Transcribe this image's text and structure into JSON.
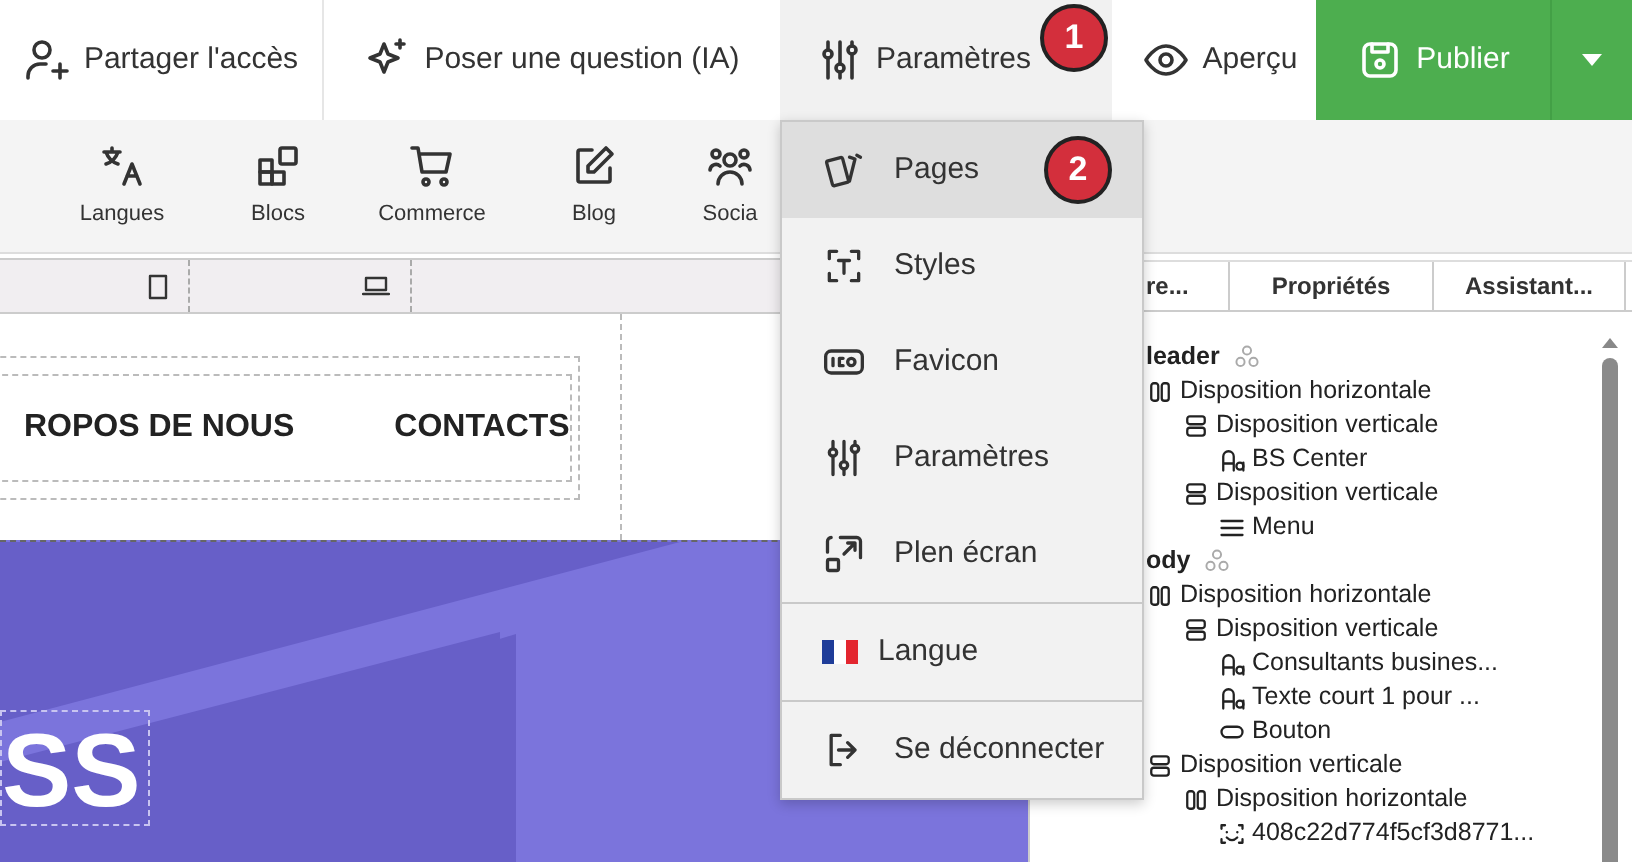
{
  "top_bar": {
    "items": [
      {
        "kind": "share",
        "label": "Partager l'accès",
        "selected": false
      },
      {
        "kind": "ai",
        "label": "Poser une question (IA)",
        "selected": false
      },
      {
        "kind": "settings",
        "label": "Paramètres",
        "selected": true
      },
      {
        "kind": "preview",
        "label": "Aperçu",
        "selected": false
      }
    ],
    "publish_button": {
      "label": "Publier"
    }
  },
  "toolbar": {
    "items": [
      {
        "kind": "languages",
        "label": "Langues"
      },
      {
        "kind": "blocks",
        "label": "Blocs"
      },
      {
        "kind": "commerce",
        "label": "Commerce"
      },
      {
        "kind": "blog",
        "label": "Blog"
      },
      {
        "kind": "social",
        "label": "Socia"
      }
    ]
  },
  "canvas": {
    "nav_links": [
      "ROPOS DE NOUS",
      "CONTACTS"
    ],
    "hero_heading": "SS"
  },
  "panel": {
    "tabs": [
      {
        "label": "re..."
      },
      {
        "label": "Propriétés"
      },
      {
        "label": "Assistant..."
      }
    ],
    "tree": [
      {
        "kind": "root",
        "label": "leader",
        "children": [
          {
            "kind": "hlayout",
            "label": "Disposition horizontale",
            "children": [
              {
                "kind": "vlayout",
                "label": "Disposition verticale",
                "children": [
                  {
                    "kind": "text",
                    "label": "BS Center"
                  }
                ]
              },
              {
                "kind": "vlayout",
                "label": "Disposition verticale",
                "children": [
                  {
                    "kind": "menu",
                    "label": "Menu"
                  }
                ]
              }
            ]
          }
        ]
      },
      {
        "kind": "root",
        "label": "ody",
        "children": [
          {
            "kind": "hlayout",
            "label": "Disposition horizontale",
            "children": [
              {
                "kind": "vlayout",
                "label": "Disposition verticale",
                "children": [
                  {
                    "kind": "text",
                    "label": "Consultants busines..."
                  },
                  {
                    "kind": "text",
                    "label": "Texte court 1 pour ..."
                  },
                  {
                    "kind": "button",
                    "label": "Bouton"
                  }
                ]
              }
            ]
          },
          {
            "kind": "vlayout",
            "label": "Disposition verticale",
            "children": [
              {
                "kind": "hlayout",
                "label": "Disposition horizontale",
                "children": [
                  {
                    "kind": "image",
                    "label": "408c22d774f5cf3d8771..."
                  }
                ]
              }
            ]
          }
        ]
      }
    ]
  },
  "dropdown_menu": {
    "sections": [
      [
        {
          "kind": "pages",
          "label": "Pages",
          "highlighted": true
        },
        {
          "kind": "styles",
          "label": "Styles",
          "highlighted": false
        },
        {
          "kind": "favicon",
          "label": "Favicon",
          "highlighted": false
        },
        {
          "kind": "settings",
          "label": "Paramètres",
          "highlighted": false
        },
        {
          "kind": "fullscreen",
          "label": "Plen écran",
          "highlighted": false
        }
      ],
      [
        {
          "kind": "flag",
          "label": "Langue",
          "highlighted": false
        }
      ],
      [
        {
          "kind": "logout",
          "label": "Se déconnecter",
          "highlighted": false
        }
      ]
    ]
  },
  "step_markers": [
    {
      "label": "1"
    },
    {
      "label": "2"
    }
  ]
}
